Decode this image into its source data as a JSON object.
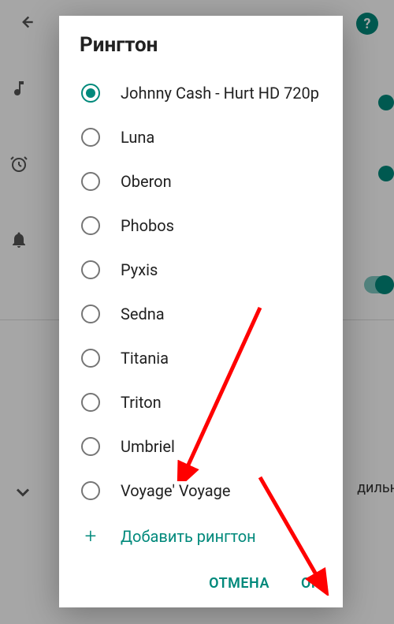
{
  "dialog": {
    "title": "Рингтон",
    "options": [
      {
        "label": "Johnny Cash - Hurt HD 720p",
        "selected": true
      },
      {
        "label": "Luna",
        "selected": false
      },
      {
        "label": "Oberon",
        "selected": false
      },
      {
        "label": "Phobos",
        "selected": false
      },
      {
        "label": "Pyxis",
        "selected": false
      },
      {
        "label": "Sedna",
        "selected": false
      },
      {
        "label": "Titania",
        "selected": false
      },
      {
        "label": "Triton",
        "selected": false
      },
      {
        "label": "Umbriel",
        "selected": false
      },
      {
        "label": "Voyage' Voyage",
        "selected": false
      }
    ],
    "add_ringtone_label": "Добавить рингтон",
    "cancel_label": "ОТМЕНА",
    "ok_label": "ОК"
  },
  "background": {
    "help_label": "?",
    "partial_text": "дильн"
  },
  "colors": {
    "accent": "#00897b",
    "arrow": "#ff0000"
  }
}
